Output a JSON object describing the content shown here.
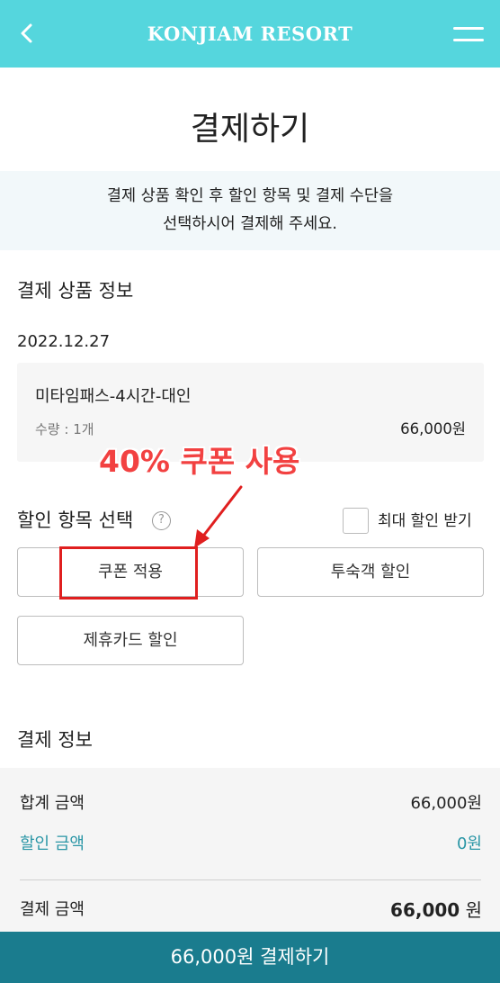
{
  "header": {
    "brand": "KONJIAM RESORT",
    "back_icon": "chevron-left-icon",
    "menu_icon": "hamburger-menu-icon",
    "background": "#55d6dd"
  },
  "page": {
    "title": "결제하기",
    "notice_line1": "결제 상품 확인 후 할인 항목 및 결제 수단을",
    "notice_line2": "선택하시어 결제해 주세요."
  },
  "product_section": {
    "title": "결제 상품 정보",
    "date": "2022.12.27",
    "item": {
      "name": "미타임패스-4시간-대인",
      "quantity": "수량 : 1개",
      "price": "66,000원"
    }
  },
  "annotation": {
    "text": "40% 쿠폰 사용",
    "color": "#f24141"
  },
  "discount_section": {
    "title": "할인 항목 선택",
    "help_icon": "question-circle-icon",
    "max_discount_label": "최대 할인 받기",
    "max_discount_checked": false,
    "buttons": {
      "coupon": "쿠폰 적용",
      "guest": "투숙객 할인",
      "card": "제휴카드 할인"
    }
  },
  "payment_section": {
    "title": "결제 정보",
    "total_label": "합계 금액",
    "total_value": "66,000원",
    "discount_label": "할인 금액",
    "discount_value": "0원",
    "final_label": "결제 금액",
    "final_amount": "66,000",
    "final_unit": "원",
    "accent_color": "#2a96a6"
  },
  "pay_button": {
    "label": "66,000원 결제하기",
    "background": "#1a7c8e"
  }
}
